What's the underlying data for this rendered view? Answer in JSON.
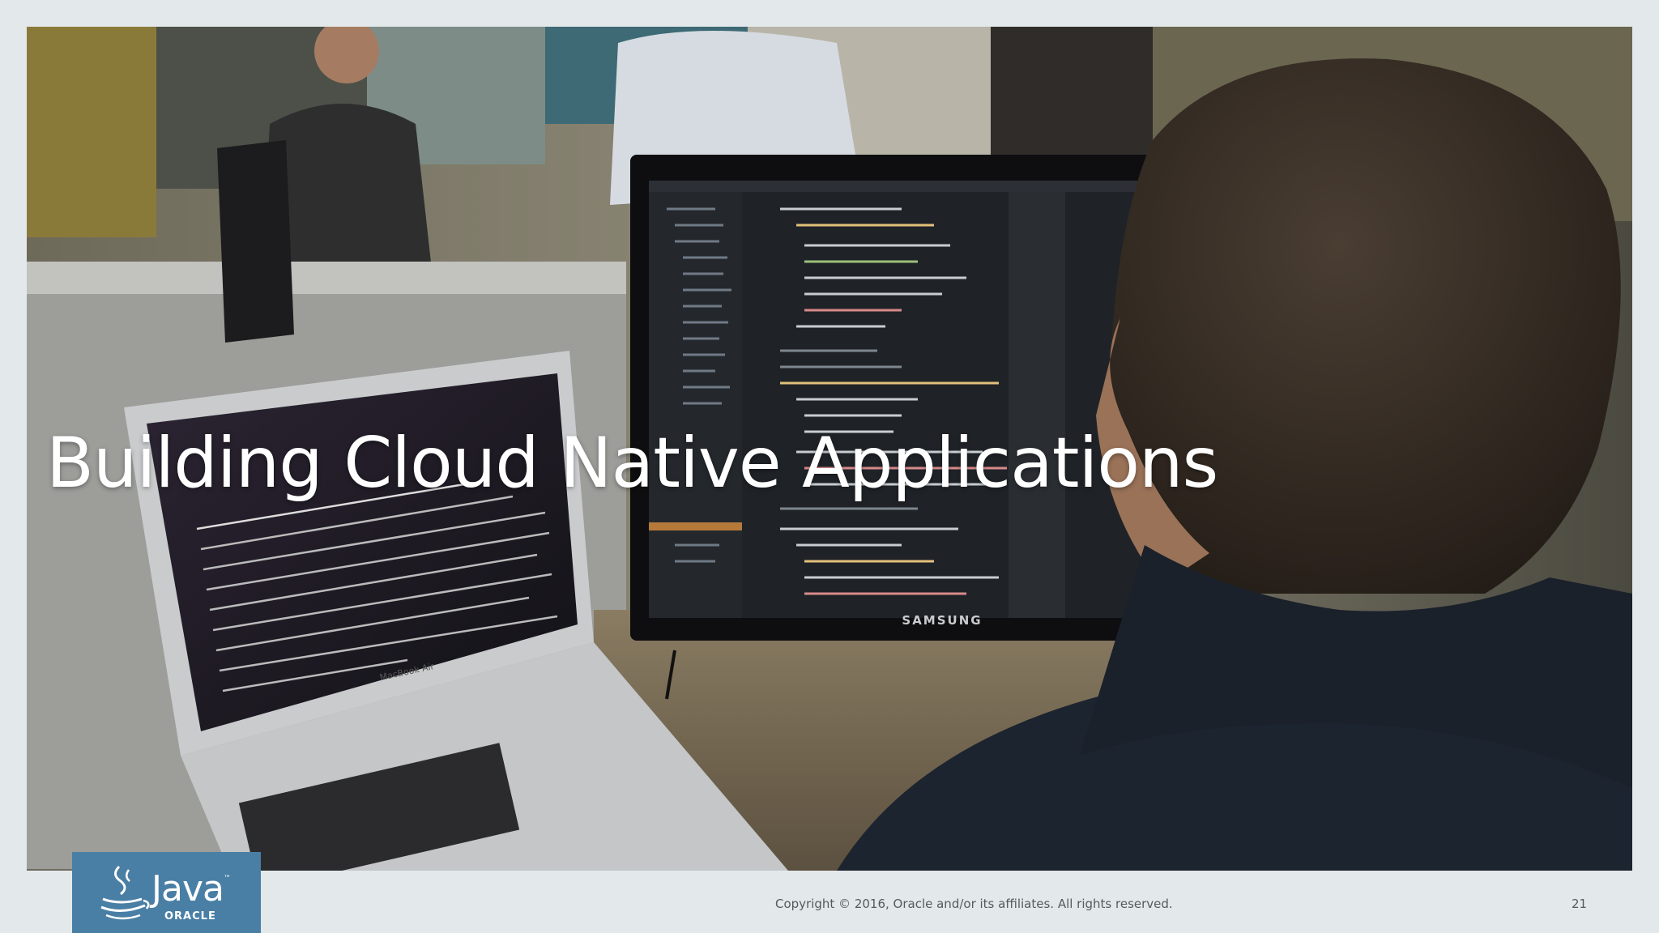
{
  "slide": {
    "title": "Building Cloud Native Applications",
    "copyright": "Copyright © 2016, Oracle and/or its affiliates. All rights reserved.",
    "page_number": "21"
  },
  "logo": {
    "product": "Java",
    "trademark": "™",
    "company": "ORACLE",
    "icon": "java-cup-icon"
  },
  "photo": {
    "monitor_brand": "SAMSUNG",
    "laptop_brand": "MacBook Air"
  },
  "colors": {
    "background": "#e3e8ea",
    "logo_blue": "#4a7fa5",
    "title_text": "#ffffff",
    "footer_text": "#555a5e"
  }
}
